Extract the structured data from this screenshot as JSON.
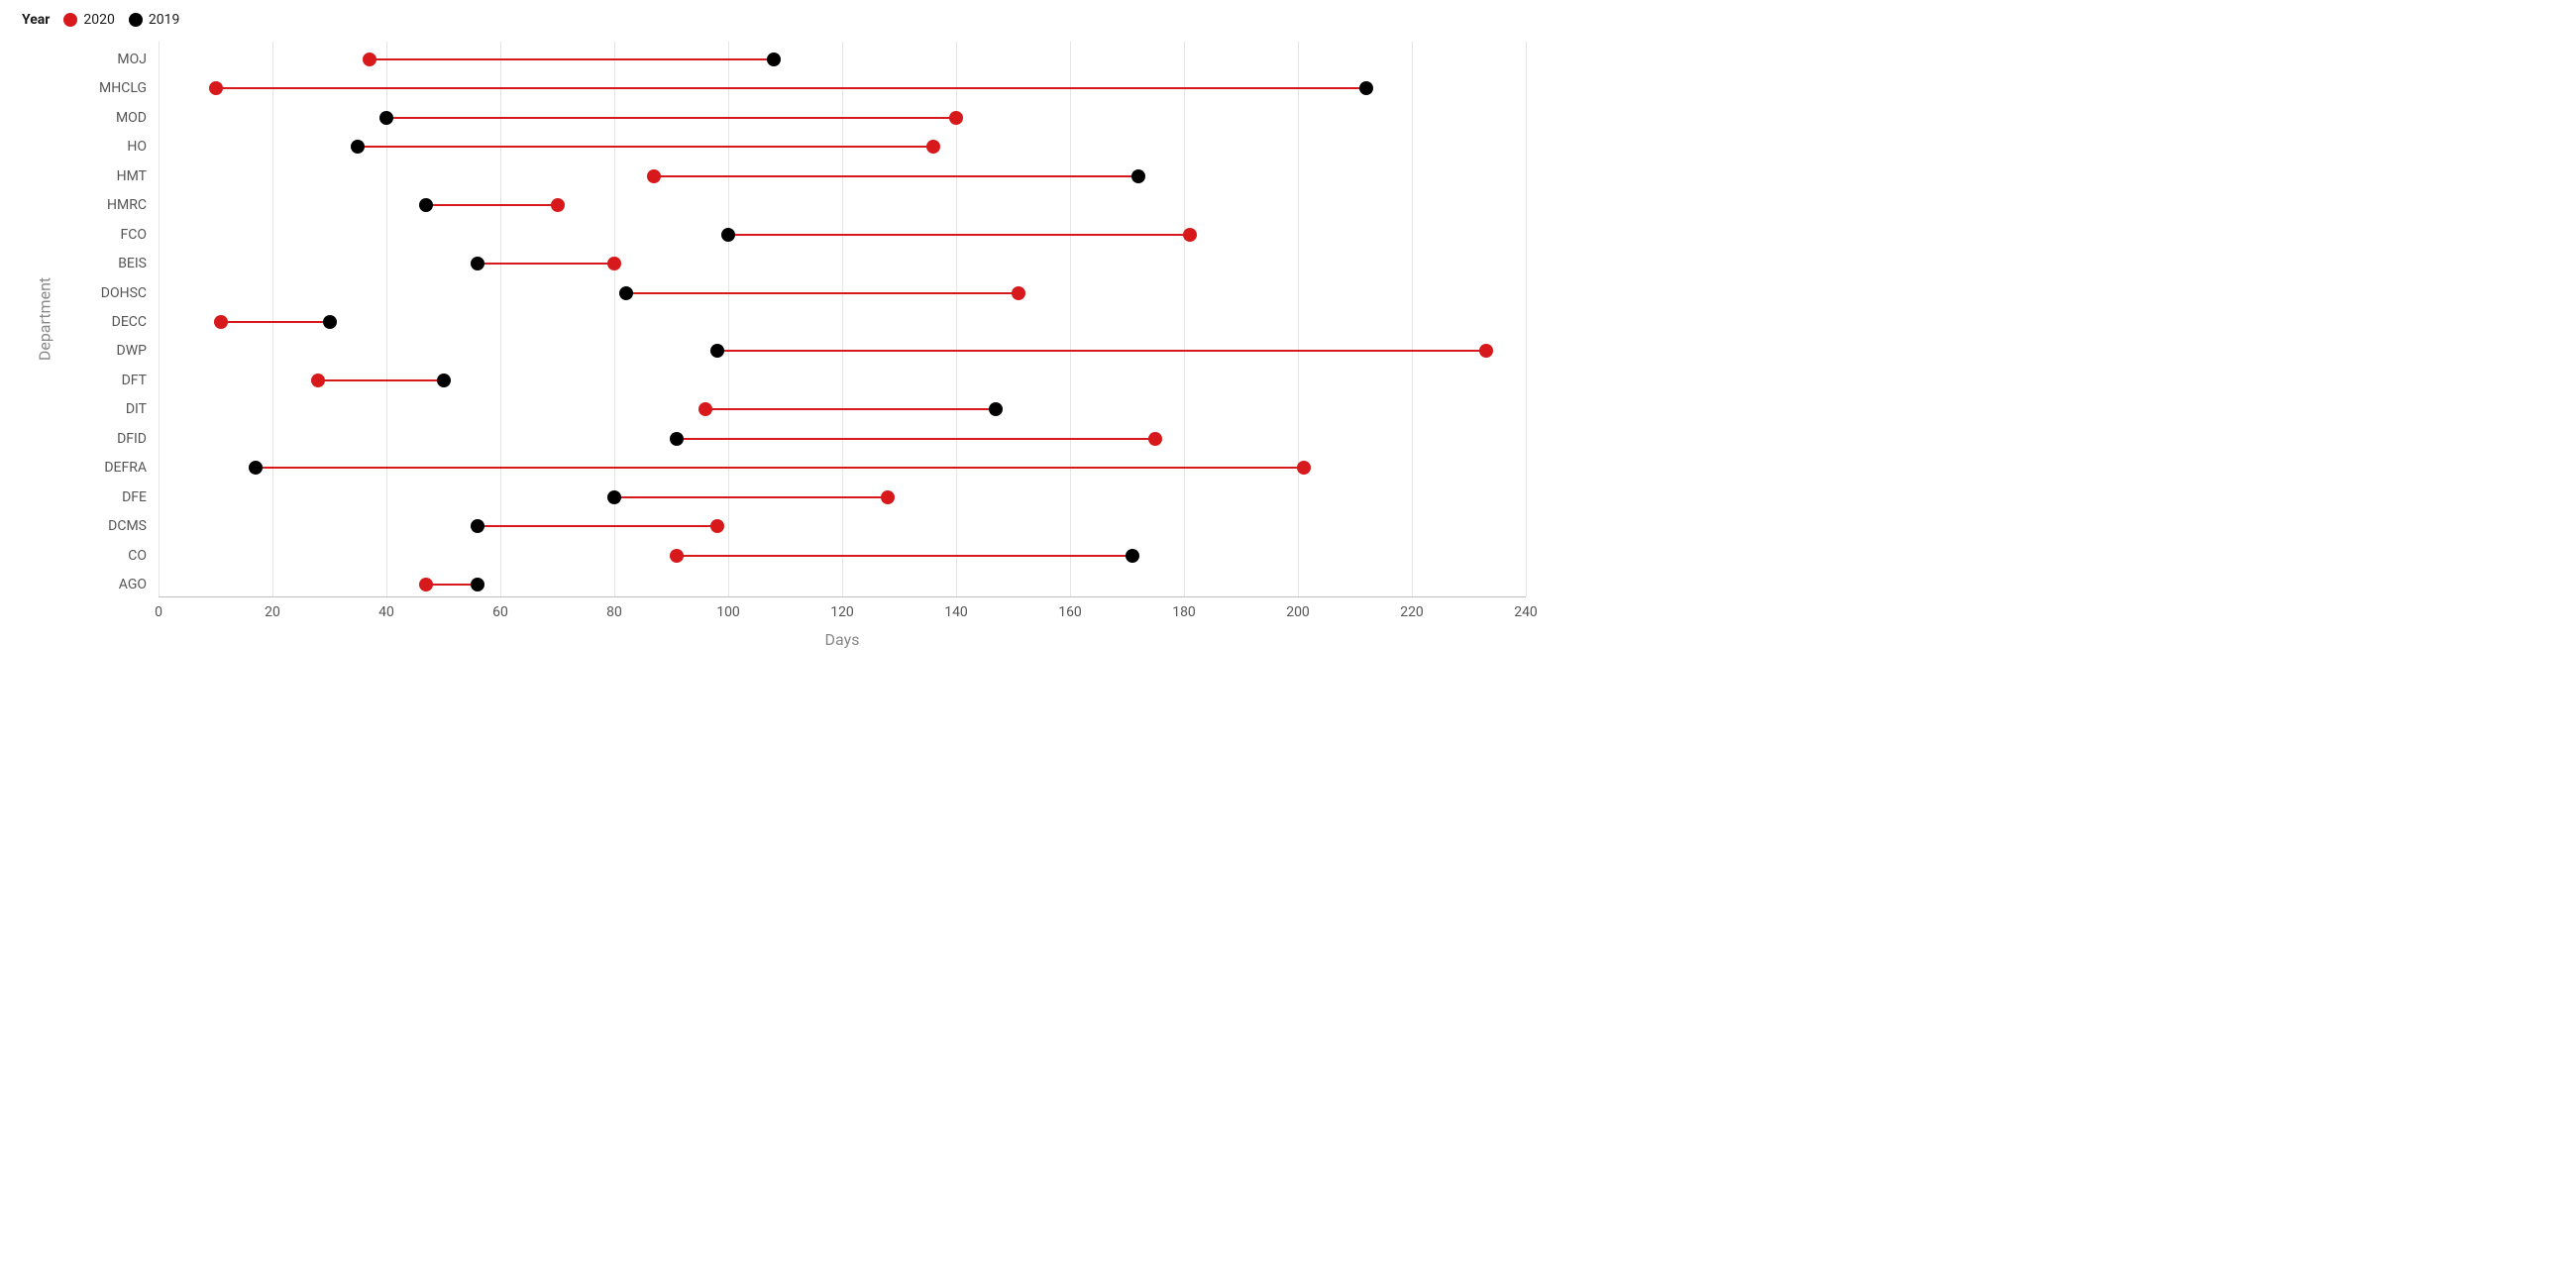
{
  "legend": {
    "title": "Year",
    "items": [
      {
        "name": "2020",
        "color": "#d7191c"
      },
      {
        "name": "2019",
        "color": "#000000"
      }
    ]
  },
  "axes": {
    "x": {
      "label": "Days",
      "min": 0,
      "max": 240,
      "step": 20
    },
    "y": {
      "label": "Department"
    }
  },
  "colors": {
    "bar": "#d7191c",
    "grid": "#e5e5e5"
  },
  "chart_data": {
    "type": "dumbbell",
    "xlabel": "Days",
    "ylabel": "Department",
    "xlim": [
      0,
      240
    ],
    "series_names": [
      "2020",
      "2019"
    ],
    "series_colors": {
      "2020": "#d7191c",
      "2019": "#000000"
    },
    "rows": [
      {
        "dept": "MOJ",
        "v2020": 37,
        "v2019": 108
      },
      {
        "dept": "MHCLG",
        "v2020": 10,
        "v2019": 212
      },
      {
        "dept": "MOD",
        "v2020": 140,
        "v2019": 40
      },
      {
        "dept": "HO",
        "v2020": 136,
        "v2019": 35
      },
      {
        "dept": "HMT",
        "v2020": 87,
        "v2019": 172
      },
      {
        "dept": "HMRC",
        "v2020": 70,
        "v2019": 47
      },
      {
        "dept": "FCO",
        "v2020": 181,
        "v2019": 100
      },
      {
        "dept": "BEIS",
        "v2020": 80,
        "v2019": 56
      },
      {
        "dept": "DOHSC",
        "v2020": 151,
        "v2019": 82
      },
      {
        "dept": "DECC",
        "v2020": 11,
        "v2019": 30
      },
      {
        "dept": "DWP",
        "v2020": 233,
        "v2019": 98
      },
      {
        "dept": "DFT",
        "v2020": 28,
        "v2019": 50
      },
      {
        "dept": "DIT",
        "v2020": 96,
        "v2019": 147
      },
      {
        "dept": "DFID",
        "v2020": 175,
        "v2019": 91
      },
      {
        "dept": "DEFRA",
        "v2020": 201,
        "v2019": 17
      },
      {
        "dept": "DFE",
        "v2020": 128,
        "v2019": 80
      },
      {
        "dept": "DCMS",
        "v2020": 98,
        "v2019": 56
      },
      {
        "dept": "CO",
        "v2020": 91,
        "v2019": 171
      },
      {
        "dept": "AGO",
        "v2020": 47,
        "v2019": 56
      }
    ]
  }
}
